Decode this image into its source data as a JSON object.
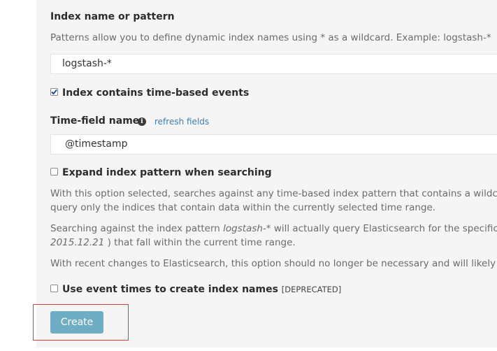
{
  "index": {
    "label": "Index name or pattern",
    "help": "Patterns allow you to define dynamic index names using * as a wildcard. Example: logstash-*",
    "value": "logstash-*"
  },
  "time_based": {
    "label": "Index contains time-based events",
    "checked": true
  },
  "time_field": {
    "label": "Time-field name",
    "info_icon": "info-icon",
    "refresh_link": "refresh fields",
    "value": "@timestamp"
  },
  "expand": {
    "label": "Expand index pattern when searching",
    "checked": false,
    "para1_line1": "With this option selected, searches against any time-based index pattern that contains a wildca",
    "para1_line2": "query only the indices that contain data within the currently selected time range.",
    "para2_line1_a": "Searching against the index pattern ",
    "para2_line1_pattern": "logstash-*",
    "para2_line1_b": " will actually query Elasticsearch for the specific",
    "para2_line2_date": "2015.12.21",
    "para2_line2_b": " ) that fall within the current time range.",
    "para3": "With recent changes to Elasticsearch, this option should no longer be necessary and will likely b"
  },
  "event_times": {
    "label": "Use event times to create index names",
    "tag": "[DEPRECATED]",
    "checked": false
  },
  "create_button": "Create",
  "colors": {
    "panel_bg": "#f5f5f5",
    "button_bg": "#6eadc3",
    "link": "#3a7fb3",
    "highlight": "#d63f3f"
  }
}
